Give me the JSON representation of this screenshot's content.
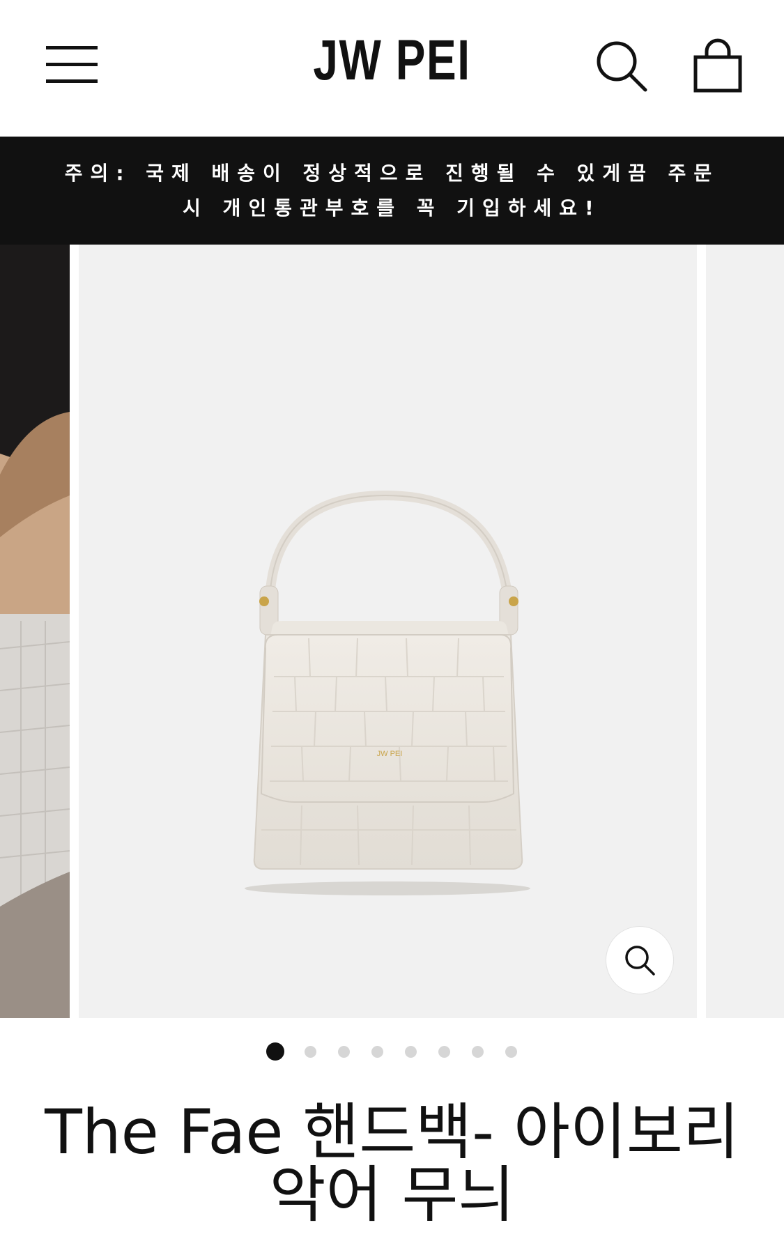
{
  "header": {
    "logo": "JW PEI",
    "menu_icon": "hamburger-menu-icon",
    "search_icon": "search-icon",
    "cart_icon": "shopping-bag-icon"
  },
  "announcement": {
    "text": "주의: 국제 배송이 정상적으로 진행될 수 있게끔 주문 시 개인통관부호를 꼭 기입하세요!"
  },
  "gallery": {
    "product_image_icon": "handbag-image",
    "zoom_icon": "zoom-icon",
    "bag_brand_stamp": "JW PEI",
    "slide_count": 8,
    "active_slide": 1
  },
  "product": {
    "title": "The Fae 핸드백- 아이보리 악어 무늬"
  },
  "colors": {
    "announcement_bg": "#111111",
    "image_bg": "#f1f1f1",
    "dot_active": "#111111",
    "dot_inactive": "#d6d6d6"
  }
}
